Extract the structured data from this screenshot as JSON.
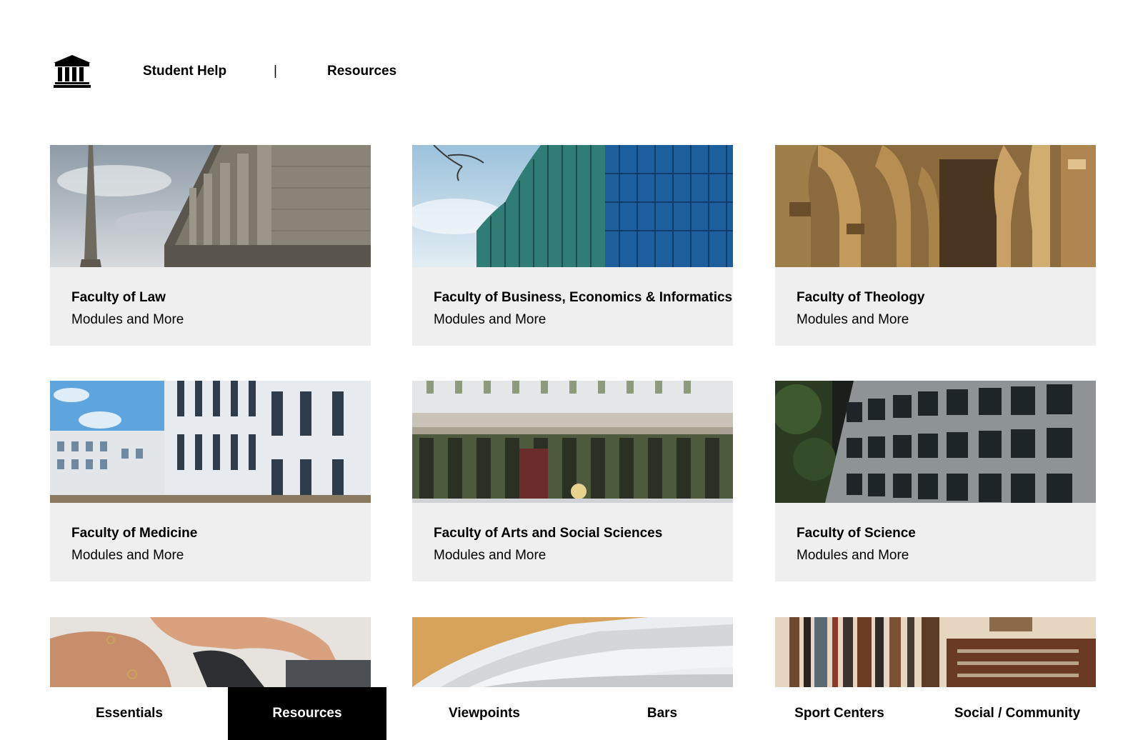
{
  "header": {
    "logo_icon": "institution-icon",
    "nav": [
      {
        "label": "Student Help"
      },
      {
        "label": "|"
      },
      {
        "label": "Resources"
      }
    ]
  },
  "cards": [
    {
      "title": "Faculty of Law",
      "subtitle": "Modules and More"
    },
    {
      "title": "Faculty of Business, Economics & Informatics",
      "subtitle": "Modules and More"
    },
    {
      "title": "Faculty of Theology",
      "subtitle": "Modules and More"
    },
    {
      "title": "Faculty of Medicine",
      "subtitle": "Modules and More"
    },
    {
      "title": "Faculty of Arts and Social Sciences",
      "subtitle": "Modules and More"
    },
    {
      "title": "Faculty of Science",
      "subtitle": "Modules and More"
    }
  ],
  "tabs": [
    {
      "label": "Essentials"
    },
    {
      "label": "Resources",
      "active": true
    },
    {
      "label": "Viewpoints"
    },
    {
      "label": "Bars"
    },
    {
      "label": "Sport Centers"
    },
    {
      "label": "Social / Community"
    }
  ],
  "colors": {
    "card_bg": "#efefef",
    "active_tab_bg": "#000000",
    "active_tab_text": "#ffffff"
  }
}
